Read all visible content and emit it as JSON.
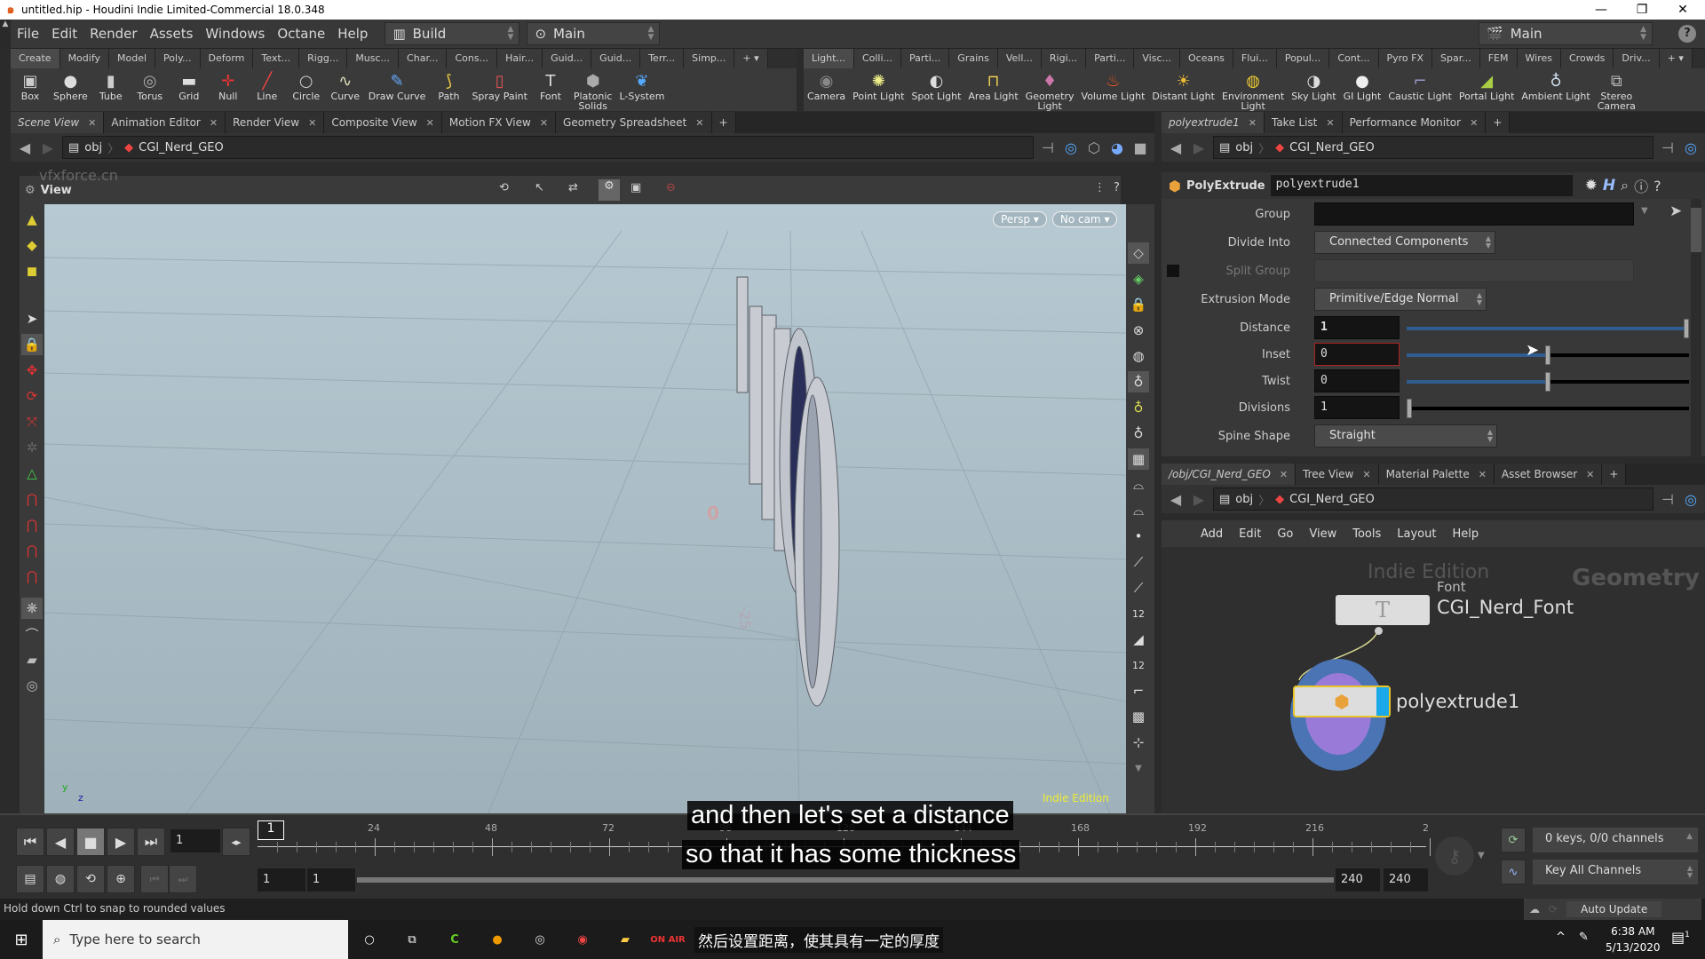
{
  "window": {
    "title": "untitled.hip - Houdini Indie Limited-Commercial 18.0.348",
    "logo": "houdini-logo-icon",
    "controls": [
      "—",
      "❐",
      "✕"
    ]
  },
  "menubar": {
    "items": [
      "File",
      "Edit",
      "Render",
      "Assets",
      "Windows",
      "Octane",
      "Help"
    ],
    "desktop": "Build",
    "context": "Main",
    "right_context": "Main",
    "help": "?"
  },
  "shelf_left": {
    "tabs": [
      "Create",
      "Modify",
      "Model",
      "Poly...",
      "Deform",
      "Text...",
      "Rigg...",
      "Musc...",
      "Char...",
      "Cons...",
      "Hair...",
      "Guid...",
      "Guid...",
      "Terr...",
      "Simp..."
    ],
    "tools": [
      {
        "label": "Box",
        "icon": "box-icon",
        "glyph": "▣",
        "color": "#ccc"
      },
      {
        "label": "Sphere",
        "icon": "sphere-icon",
        "glyph": "●",
        "color": "#ddd"
      },
      {
        "label": "Tube",
        "icon": "tube-icon",
        "glyph": "▮",
        "color": "#ccc"
      },
      {
        "label": "Torus",
        "icon": "torus-icon",
        "glyph": "◎",
        "color": "#aaa"
      },
      {
        "label": "Grid",
        "icon": "grid-icon",
        "glyph": "▬",
        "color": "#ddd"
      },
      {
        "label": "Null",
        "icon": "null-icon",
        "glyph": "✛",
        "color": "#e33"
      },
      {
        "label": "Line",
        "icon": "line-icon",
        "glyph": "╱",
        "color": "#e44"
      },
      {
        "label": "Circle",
        "icon": "circle-icon",
        "glyph": "○",
        "color": "#ccc"
      },
      {
        "label": "Curve",
        "icon": "curve-icon",
        "glyph": "∿",
        "color": "#ddb"
      },
      {
        "label": "Draw Curve",
        "icon": "draw-curve-icon",
        "glyph": "✎",
        "color": "#6af"
      },
      {
        "label": "Path",
        "icon": "path-icon",
        "glyph": "⟆",
        "color": "#ec4"
      },
      {
        "label": "Spray Paint",
        "icon": "spray-paint-icon",
        "glyph": "▯",
        "color": "#e55"
      },
      {
        "label": "Font",
        "icon": "font-icon",
        "glyph": "T",
        "color": "#ddd"
      },
      {
        "label": "Platonic\nSolids",
        "icon": "platonic-solids-icon",
        "glyph": "⬢",
        "color": "#aaa"
      },
      {
        "label": "L-System",
        "icon": "l-system-icon",
        "glyph": "❦",
        "color": "#5af"
      }
    ]
  },
  "shelf_right": {
    "tabs": [
      "Light...",
      "Colli...",
      "Parti...",
      "Grains",
      "Vell...",
      "Rigi...",
      "Parti...",
      "Visc...",
      "Oceans",
      "Flui...",
      "Popul...",
      "Cont...",
      "Pyro FX",
      "Spar...",
      "FEM",
      "Wires",
      "Crowds",
      "Driv..."
    ],
    "tools": [
      {
        "label": "Camera",
        "icon": "camera-icon",
        "glyph": "◉",
        "color": "#888"
      },
      {
        "label": "Point Light",
        "icon": "point-light-icon",
        "glyph": "✺",
        "color": "#ee8"
      },
      {
        "label": "Spot Light",
        "icon": "spot-light-icon",
        "glyph": "◐",
        "color": "#ddd"
      },
      {
        "label": "Area Light",
        "icon": "area-light-icon",
        "glyph": "⊓",
        "color": "#ec5"
      },
      {
        "label": "Geometry\nLight",
        "icon": "geometry-light-icon",
        "glyph": "♦",
        "color": "#c7a"
      },
      {
        "label": "Volume Light",
        "icon": "volume-light-icon",
        "glyph": "♨",
        "color": "#e52"
      },
      {
        "label": "Distant Light",
        "icon": "distant-light-icon",
        "glyph": "☀",
        "color": "#eb3"
      },
      {
        "label": "Environment\nLight",
        "icon": "environment-light-icon",
        "glyph": "◍",
        "color": "#ec3"
      },
      {
        "label": "Sky Light",
        "icon": "sky-light-icon",
        "glyph": "◑",
        "color": "#ddd"
      },
      {
        "label": "GI Light",
        "icon": "gi-light-icon",
        "glyph": "●",
        "color": "#eee"
      },
      {
        "label": "Caustic Light",
        "icon": "caustic-light-icon",
        "glyph": "⌐",
        "color": "#99c"
      },
      {
        "label": "Portal Light",
        "icon": "portal-light-icon",
        "glyph": "◢",
        "color": "#ac4"
      },
      {
        "label": "Ambient Light",
        "icon": "ambient-light-icon",
        "glyph": "♁",
        "color": "#cde"
      },
      {
        "label": "Stereo\nCamera",
        "icon": "stereo-camera-icon",
        "glyph": "⧉",
        "color": "#bbb"
      }
    ]
  },
  "scene_pane": {
    "tabs": [
      {
        "label": "Scene View",
        "active": true
      },
      {
        "label": "Animation Editor"
      },
      {
        "label": "Render View"
      },
      {
        "label": "Composite View"
      },
      {
        "label": "Motion FX View"
      },
      {
        "label": "Geometry Spreadsheet"
      }
    ],
    "path": {
      "root": "obj",
      "node": "CGI_Nerd_GEO"
    },
    "view_label": "View",
    "watermark": "vfxforce.cn",
    "persp_btn": "Persp",
    "cam_btn": "No cam",
    "indie_watermark": "Indie Edition",
    "grid_labels": [
      "0",
      "-25"
    ],
    "axis_labels": {
      "y": "y",
      "z": "z"
    }
  },
  "params_pane": {
    "tabs": [
      {
        "label": "polyextrude1",
        "active": true
      },
      {
        "label": "Take List"
      },
      {
        "label": "Performance Monitor"
      }
    ],
    "path": {
      "root": "obj",
      "node": "CGI_Nerd_GEO"
    },
    "node_type": "PolyExtrude",
    "node_name": "polyextrude1",
    "params": {
      "group": {
        "label": "Group",
        "value": ""
      },
      "divide_into": {
        "label": "Divide Into",
        "value": "Connected Components"
      },
      "split_group": {
        "label": "Split Group",
        "value": ""
      },
      "extrusion_mode": {
        "label": "Extrusion Mode",
        "value": "Primitive/Edge Normal"
      },
      "distance": {
        "label": "Distance",
        "value": "1",
        "slider_fraction": 1.0
      },
      "inset": {
        "label": "Inset",
        "value": "0",
        "slider_fraction": 0.5
      },
      "twist": {
        "label": "Twist",
        "value": "0",
        "slider_fraction": 0.5
      },
      "divisions": {
        "label": "Divisions",
        "value": "1",
        "slider_fraction": 0.0
      },
      "spine_shape": {
        "label": "Spine Shape",
        "value": "Straight"
      }
    }
  },
  "network_pane": {
    "tabs": [
      {
        "label": "/obj/CGI_Nerd_GEO",
        "active": true
      },
      {
        "label": "Tree View"
      },
      {
        "label": "Material Palette"
      },
      {
        "label": "Asset Browser"
      }
    ],
    "path": {
      "root": "obj",
      "node": "CGI_Nerd_GEO"
    },
    "menu": [
      "Add",
      "Edit",
      "Go",
      "View",
      "Tools",
      "Layout",
      "Help"
    ],
    "watermark": "Indie Edition",
    "context_label": "Geometry",
    "nodes": [
      {
        "type": "Font",
        "name": "CGI_Nerd_Font"
      },
      {
        "type": "PolyExtrude",
        "name": "polyextrude1"
      }
    ]
  },
  "timeline": {
    "current_frame": "1",
    "marker": "1",
    "ticks": [
      "24",
      "48",
      "72",
      "96",
      "120",
      "144",
      "168",
      "192",
      "216",
      "2"
    ],
    "range_start": "1",
    "range_start2": "1",
    "range_end": "240",
    "range_end2": "240",
    "keys_status": "0 keys, 0/0 channels",
    "key_mode": "Key All Channels",
    "auto_update": "Auto Update"
  },
  "subtitles": {
    "line1": "and then let's set a distance",
    "line2": "so that it has some thickness",
    "chinese": "然后设置距离，使其具有一定的厚度"
  },
  "status": "Hold down Ctrl to snap to rounded values",
  "taskbar": {
    "search_placeholder": "Type here to search",
    "time": "6:38 AM",
    "date": "5/13/2020",
    "notifications": "1"
  }
}
